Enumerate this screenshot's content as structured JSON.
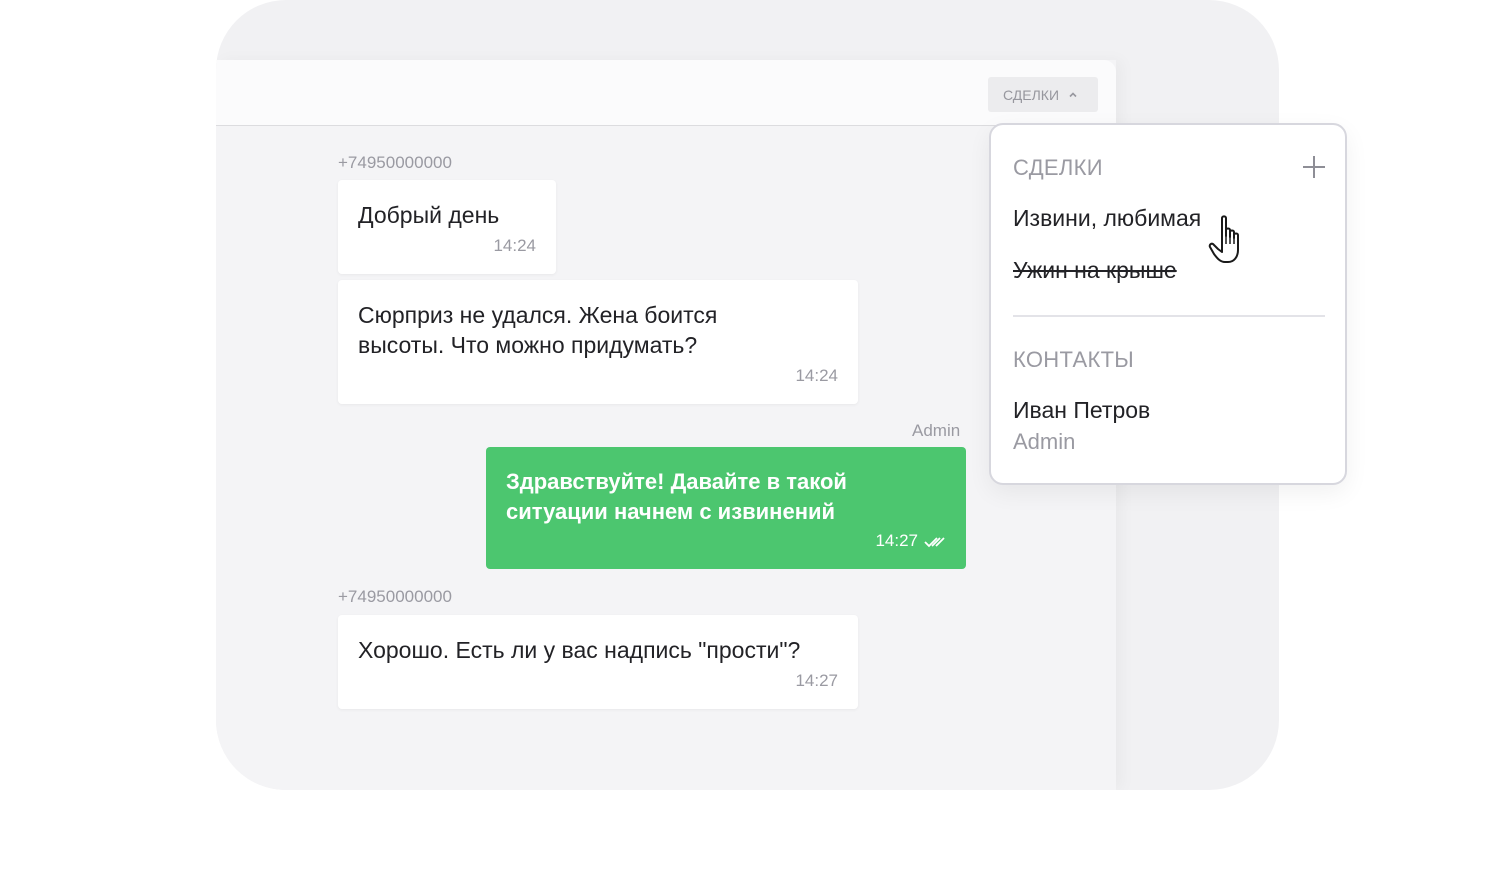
{
  "header": {
    "deals_button_label": "СДЕЛКИ"
  },
  "messages": [
    {
      "sender": "+74950000000",
      "text": "Добрый день",
      "time": "14:24",
      "direction": "in"
    },
    {
      "sender": "",
      "text_lines": [
        "Сюрприз не удался. Жена боится",
        "высоты. Что можно придумать?"
      ],
      "time": "14:24",
      "direction": "in"
    },
    {
      "sender": "Admin",
      "text_lines": [
        "Здравствуйте! Давайте в такой",
        "ситуации начнем с извинений"
      ],
      "time": "14:27",
      "direction": "out",
      "status_icon": "double-check-icon"
    },
    {
      "sender": "+74950000000",
      "text": "Хорошо. Есть ли у вас надпись \"прости\"?",
      "time": "14:27",
      "direction": "in"
    }
  ],
  "dropdown": {
    "deals_heading": "СДЕЛКИ",
    "add_icon": "plus-icon",
    "deals": [
      {
        "label": "Извини, любимая",
        "closed": false
      },
      {
        "label": "Ужин на крыше",
        "closed": true
      }
    ],
    "contacts_heading": "КОНТАКТЫ",
    "contact": {
      "name": "Иван Петров",
      "role": "Admin"
    }
  },
  "colors": {
    "outgoing_bubble": "#4cc66f",
    "muted_text": "#9a9aa2",
    "panel_bg": "#f4f4f6"
  }
}
